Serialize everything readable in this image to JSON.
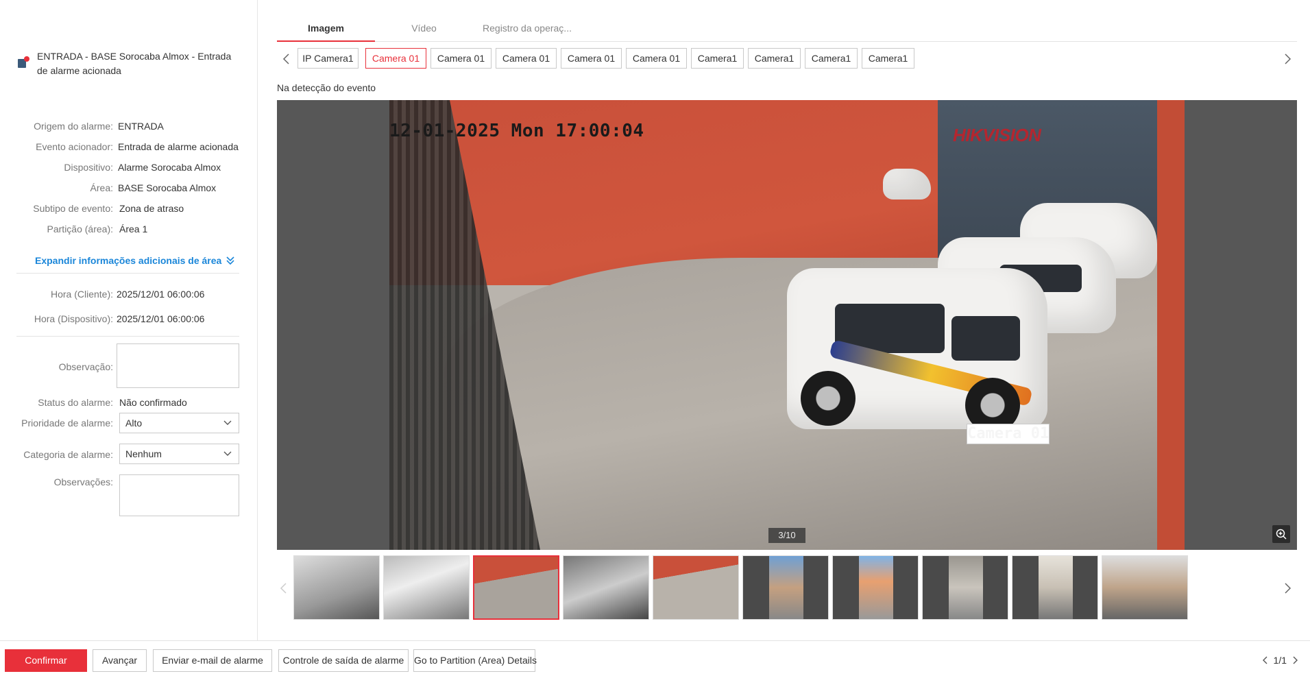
{
  "alarm": {
    "title": "ENTRADA - BASE Sorocaba Almox - Entrada de alarme acionada"
  },
  "details": [
    {
      "key": "Origem do alarme:",
      "value": "ENTRADA"
    },
    {
      "key": "Evento acionador:",
      "value": "Entrada de alarme acionada"
    },
    {
      "key": "Dispositivo:",
      "value": "Alarme Sorocaba Almox"
    },
    {
      "key": "Área:",
      "value": "BASE Sorocaba Almox"
    },
    {
      "key": "Subtipo de evento:",
      "value": "Zona de atraso"
    },
    {
      "key": "Partição (área):",
      "value": "Área 1"
    }
  ],
  "expand_label": "Expandir informações adicionais de área",
  "times": [
    {
      "key": "Hora (Cliente):",
      "value": "2025/12/01 06:00:06"
    },
    {
      "key": "Hora (Dispositivo):",
      "value": "2025/12/01 06:00:06"
    }
  ],
  "form": {
    "observacao_label": "Observação:",
    "status_label": "Status do alarme:",
    "status_value": "Não confirmado",
    "priority_label": "Prioridade de alarme:",
    "priority_value": "Alto",
    "category_label": "Categoria de alarme:",
    "category_value": "Nenhum",
    "observacoes_label": "Observações:"
  },
  "tabs": [
    "Imagem",
    "Vídeo",
    "Registro da operaç..."
  ],
  "cameras": [
    "IP Camera1",
    "Camera 01",
    "Camera 01",
    "Camera 01",
    "Camera 01",
    "Camera 01",
    "Camera1",
    "Camera1",
    "Camera1",
    "Camera1"
  ],
  "active_camera_index": 1,
  "caption": "Na detecção do evento",
  "viewer": {
    "osd_date": "12-01-2025 Mon 17:00:04",
    "osd_camera": "Camera 01",
    "brand": "HIKVISION",
    "counter": "3/10"
  },
  "thumbnail_count": 10,
  "active_thumbnail_index": 2,
  "buttons": {
    "confirm": "Confirmar",
    "advance": "Avançar",
    "email": "Enviar e-mail de alarme",
    "output": "Controle de saída de alarme",
    "partition": "Go to Partition (Area) Details"
  },
  "pager": "1/1",
  "colors": {
    "accent": "#e8303a",
    "link": "#1a86d9"
  }
}
